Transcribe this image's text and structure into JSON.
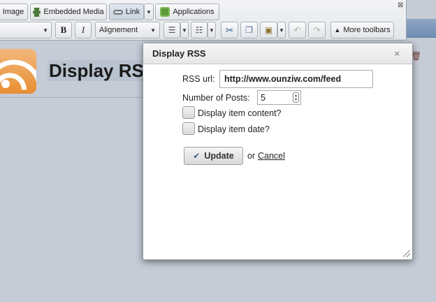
{
  "toolbar": {
    "row1": {
      "image_label": "Image",
      "embedded_media_label": "Embedded Media",
      "link_label": "Link",
      "applications_label": "Applications"
    },
    "row2": {
      "bold_label": "B",
      "italic_label": "I",
      "alignment_label": "Alignement",
      "more_toolbars_label": "More toolbars"
    }
  },
  "page": {
    "title": "Display RSS"
  },
  "dialog": {
    "title": "Display RSS",
    "rss_url_label": "RSS url:",
    "rss_url_value": "http://www.ounziw.com/feed",
    "num_posts_label": "Number of Posts:",
    "num_posts_value": "5",
    "display_content_label": "Display item content?",
    "display_content_checked": false,
    "display_date_label": "Display item date?",
    "display_date_checked": false,
    "update_label": "Update",
    "or_text": "or",
    "cancel_label": "Cancel"
  }
}
